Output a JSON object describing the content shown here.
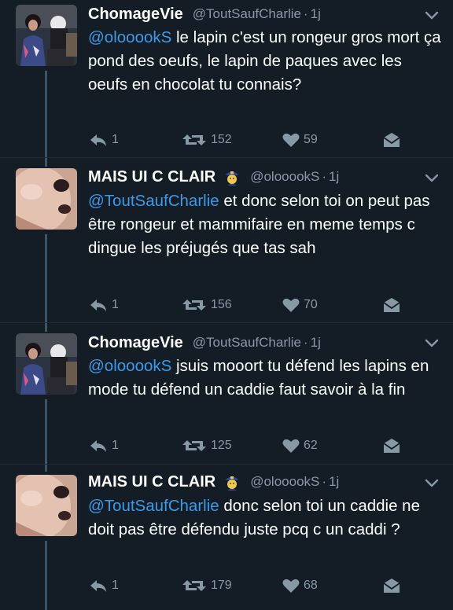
{
  "tweets": [
    {
      "display_name": "ChomageVie",
      "handle": "@ToutSaufCharlie",
      "dot": "·",
      "time": "1j",
      "has_badge": false,
      "mention": "@olooookS",
      "text": " le lapin c'est un rongeur gros mort ça pond des oeufs, le lapin de paques avec les oeufs en chocolat tu connais?",
      "reply_count": "1",
      "retweet_count": "152",
      "like_count": "59",
      "avatar": "avatar-two-people",
      "icons": [
        "reply-icon",
        "retweet-icon",
        "heart-icon",
        "message-icon",
        "chevron-down-icon"
      ]
    },
    {
      "display_name": "MAIS UI C CLAIR",
      "handle": "@olooookS",
      "dot": "·",
      "time": "1j",
      "has_badge": true,
      "badge_icon": "police-officer-emoji",
      "mention": "@ToutSaufCharlie",
      "text": " et donc selon toi on peut pas être rongeur et mammifaire en meme temps c dingue les préjugés que tas sah",
      "reply_count": "1",
      "retweet_count": "156",
      "like_count": "70",
      "avatar": "avatar-face-closeup"
    },
    {
      "display_name": "ChomageVie",
      "handle": "@ToutSaufCharlie",
      "dot": "·",
      "time": "1j",
      "has_badge": false,
      "mention": "@olooookS",
      "text": " jsuis mooort tu défend les lapins en mode tu défend un caddie faut savoir à la fin",
      "reply_count": "1",
      "retweet_count": "125",
      "like_count": "62",
      "avatar": "avatar-two-people"
    },
    {
      "display_name": "MAIS UI C CLAIR",
      "handle": "@olooookS",
      "dot": "·",
      "time": "1j",
      "has_badge": true,
      "badge_icon": "police-officer-emoji",
      "mention": "@ToutSaufCharlie",
      "text": " donc selon toi un caddie ne doit pas être défendu juste pcq c un caddi ?",
      "reply_count": "1",
      "retweet_count": "179",
      "like_count": "68",
      "avatar": "avatar-face-closeup"
    }
  ],
  "colors": {
    "background": "#141d26",
    "text": "#ffffff",
    "secondary": "#8899a6",
    "mention": "#3b9ae8",
    "thread_line": "#3d5466"
  }
}
